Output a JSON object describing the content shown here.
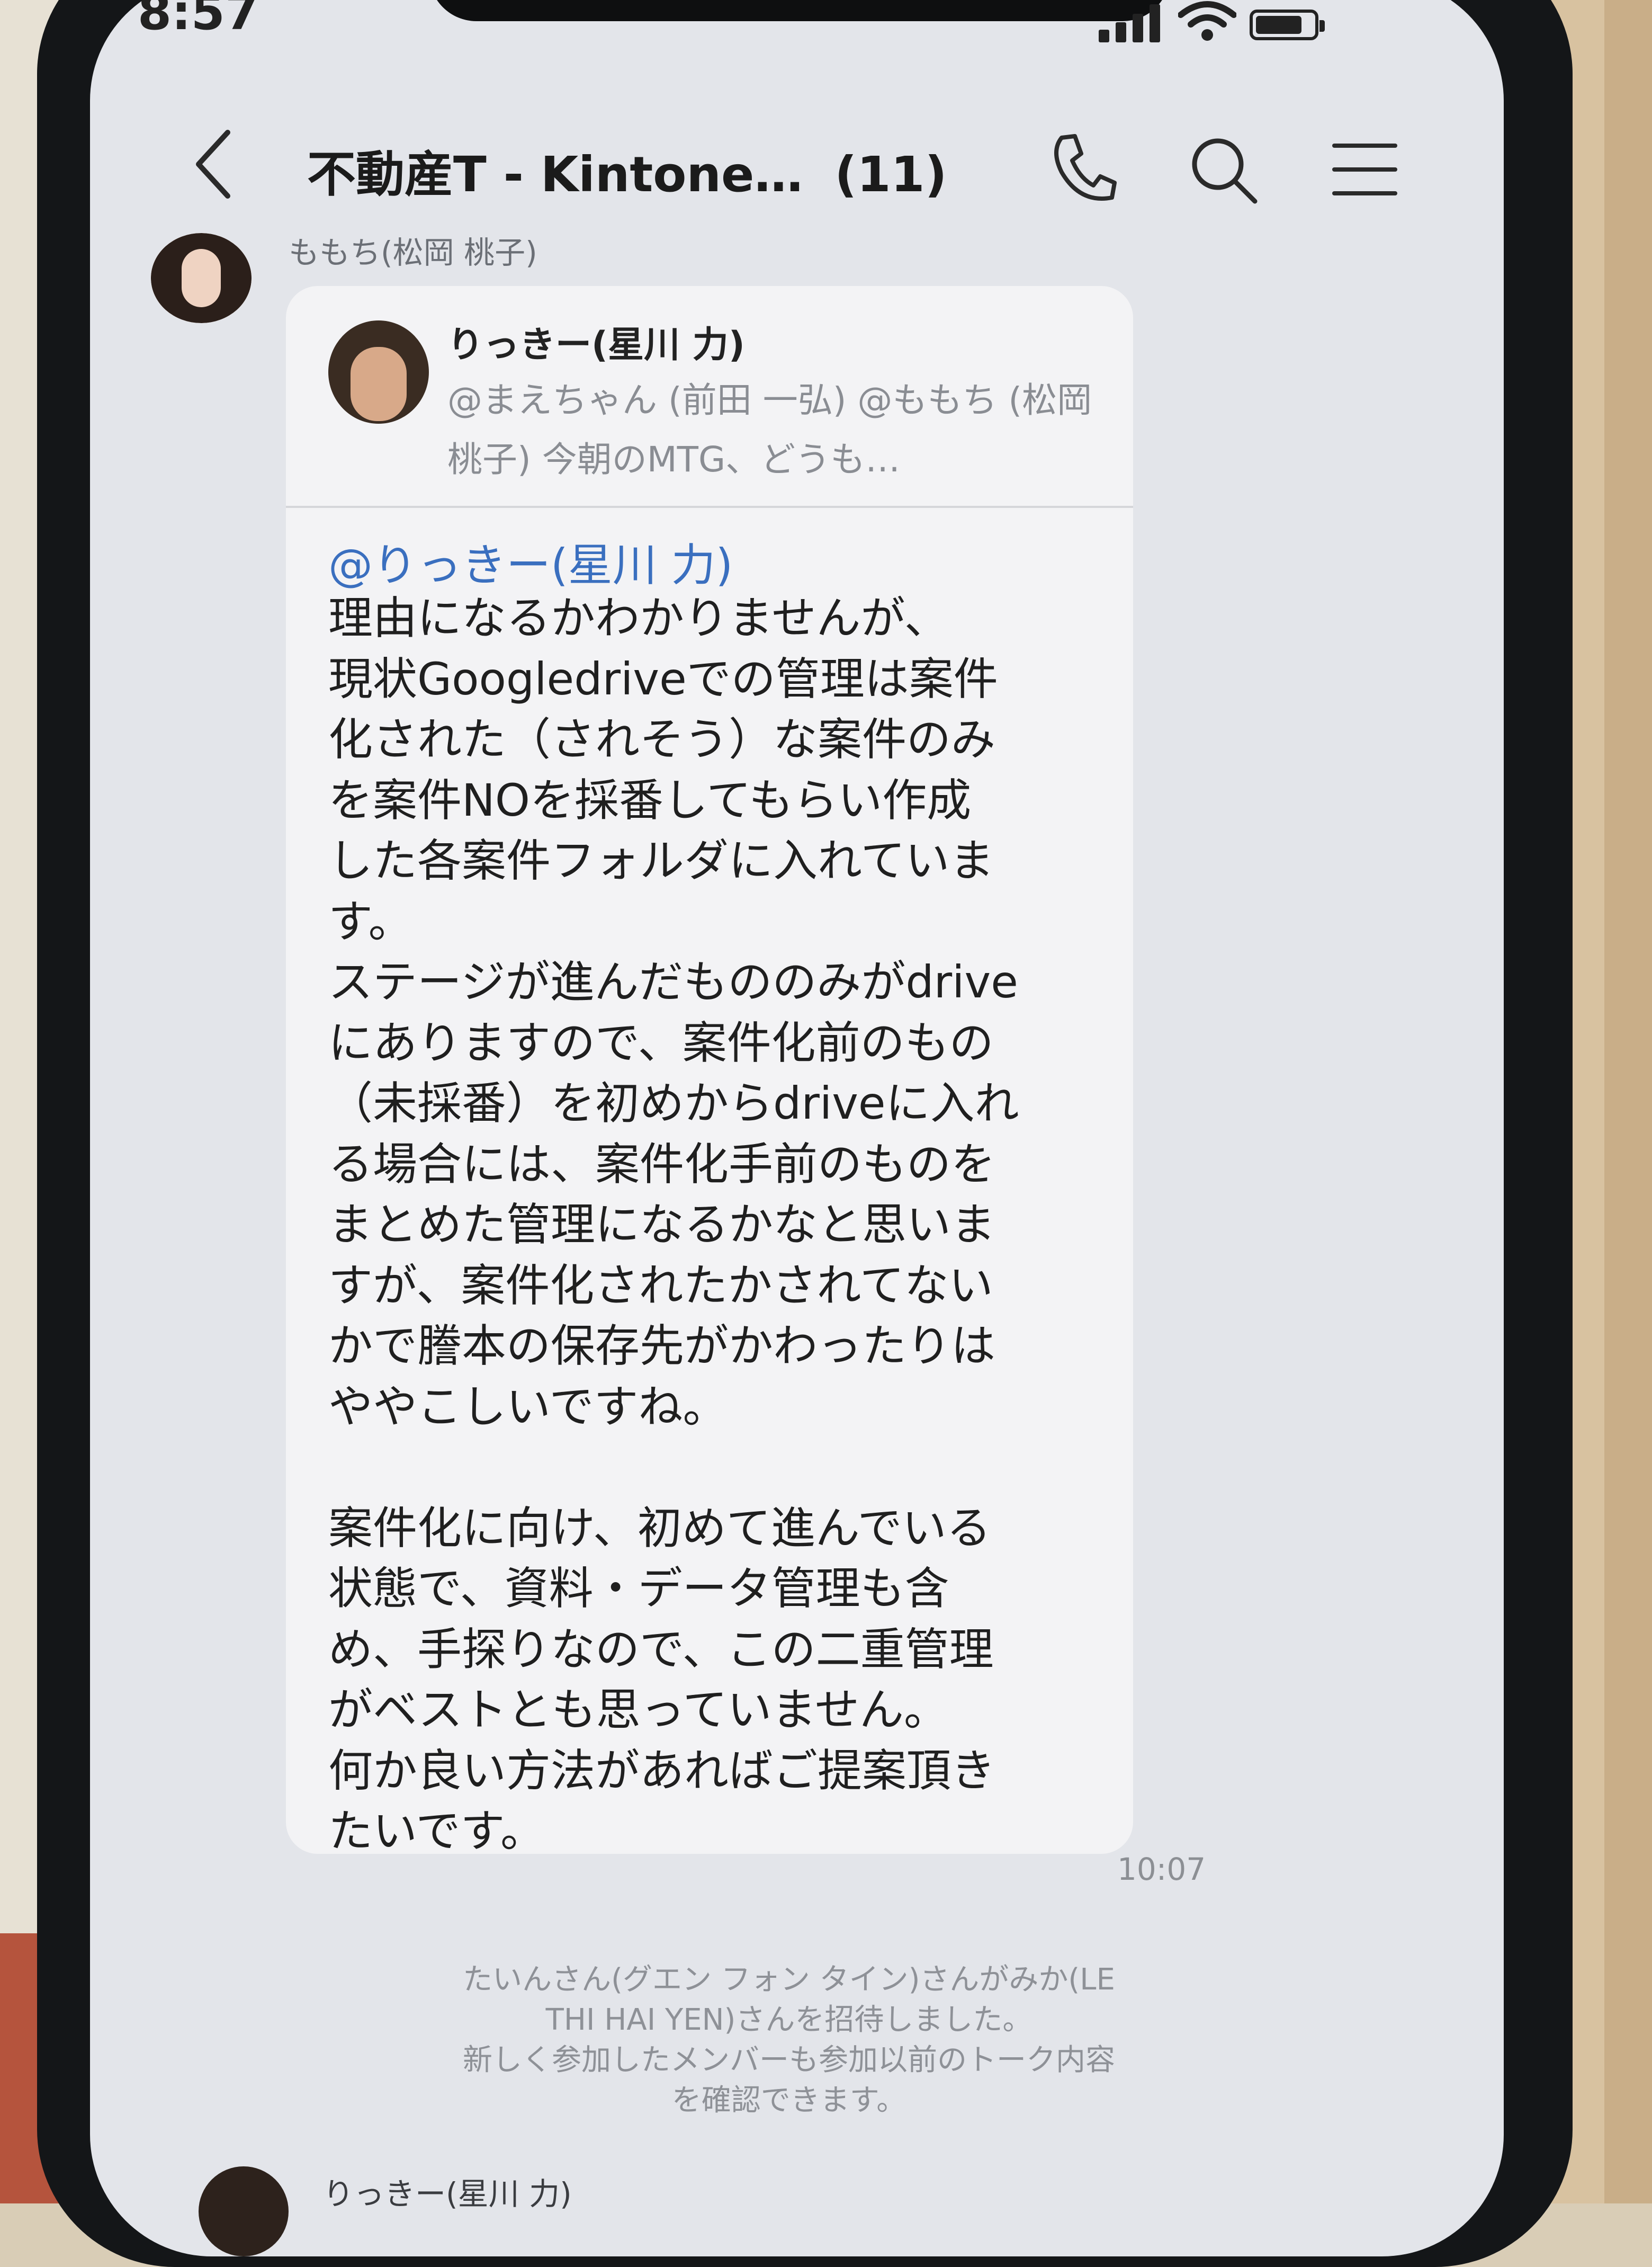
{
  "status_bar": {
    "time": "8:57"
  },
  "header": {
    "title": "不動産T - Kintone…",
    "member_count": "(11)"
  },
  "top_message": {
    "sender": "ももち(松岡 桃子)"
  },
  "reply": {
    "quoted_name": "りっきー(星川 力)",
    "quoted_preview": "@まえちゃん (前田 一弘) @ももち (松岡 桃子) 今朝のMTG、どうも…",
    "mention": "@りっきー(星川 力)",
    "body": "理由になるかわかりませんが、\n現状Googledriveでの管理は案件\n化された（されそう）な案件のみ\nを案件NOを採番してもらい作成\nした各案件フォルダに入れていま\nす。\nステージが進んだもののみがdrive\nにありますので、案件化前のもの\n（未採番）を初めからdriveに入れ\nる場合には、案件化手前のものを\nまとめた管理になるかなと思いま\nすが、案件化されたかされてない\nかで謄本の保存先がかわったりは\nややこしいですね。\n\n案件化に向け、初めて進んでいる\n状態で、資料・データ管理も含\nめ、手探りなので、この二重管理\nがベストとも思っていません。\n何か良い方法があればご提案頂き\nたいです。",
    "time": "10:07"
  },
  "system_message": "たいんさん(グエン フォン タイン)さんがみか(LE\nTHI HAI YEN)さんを招待しました。\n新しく参加したメンバーも参加以前のトーク内容\nを確認できます。",
  "bottom_message": {
    "sender": "りっきー(星川 力)"
  },
  "icons": [
    "back-arrow-icon",
    "phone-icon",
    "search-icon",
    "menu-icon",
    "signal-icon",
    "wifi-icon",
    "battery-icon"
  ]
}
